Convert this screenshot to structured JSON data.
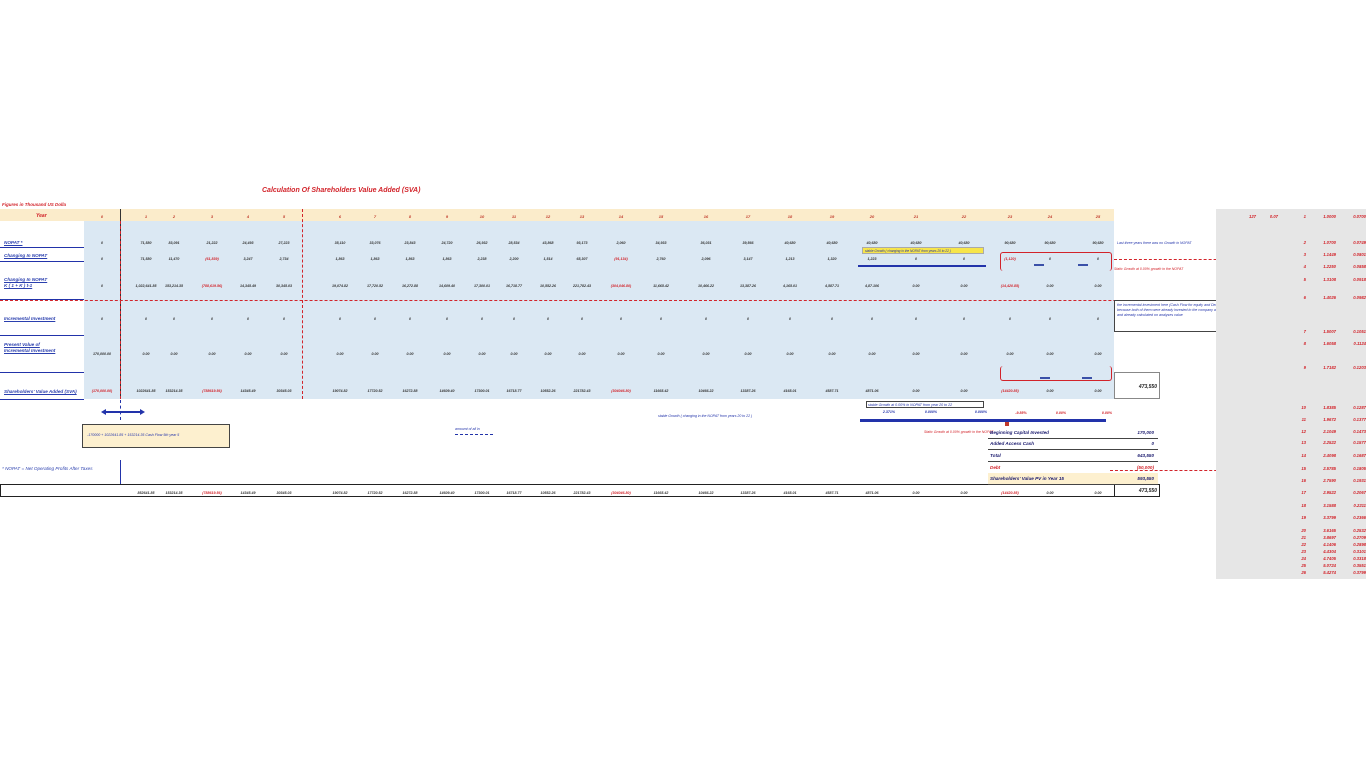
{
  "title": "Calculation Of Shareholders Value Added (SVA)",
  "figures_note": "Figures in Thousand US Dolla",
  "year_label": "Year",
  "years": [
    "0",
    "1",
    "2",
    "3",
    "4",
    "5",
    "6",
    "7",
    "8",
    "9",
    "10",
    "11",
    "12",
    "13",
    "14",
    "15",
    "16",
    "17",
    "18",
    "19",
    "20",
    "21",
    "22",
    "23",
    "24",
    "25"
  ],
  "rows": {
    "nopat": {
      "label": "NOPAT *",
      "values": [
        "0",
        "71,580",
        "83,091",
        "21,222",
        "24,493",
        "27,223",
        "35,110",
        "33,076",
        "23,843",
        "24,720",
        "26,932",
        "28,534",
        "43,868",
        "93,173",
        "2,060",
        "34,933",
        "36,031",
        "39,566",
        "40,680",
        "40,680",
        "40,680",
        "40,680",
        "40,680",
        "90,680",
        "90,680",
        "90,680"
      ]
    },
    "changing_nopat": {
      "label": "Changing In NOPAT",
      "values": [
        "0",
        "71,580",
        "11,470",
        "(61,839)",
        "3,247",
        "2,734",
        "1,863",
        "1,863",
        "1,863",
        "1,863",
        "2,238",
        "2,200",
        "1,514",
        "65,307",
        "(91,134)",
        "2,760",
        "2,096",
        "3,147",
        "1,213",
        "1,320",
        "1,223",
        "0",
        "0",
        "(1,120)",
        "0",
        "0"
      ]
    },
    "changing_nopat_k": {
      "label": "Changing In NOPAT\nK ( 1 + K ) t-1",
      "values": [
        "0",
        "1,022,641.85",
        "153,214.35",
        "(788,619.56)",
        "14,345.49",
        "30,345.03",
        "19,074.82",
        "17,720.52",
        "16,272.88",
        "14,609.40",
        "17,300.01",
        "16,718.77",
        "10,552.26",
        "221,782.43",
        "(304,046.80)",
        "11,665.42",
        "10,466.22",
        "13,387.26",
        "4,165.01",
        "4,587.71",
        "4,87.106",
        "0.00",
        "0.00",
        "(14,420.85)",
        "0.00",
        "0.00"
      ]
    },
    "incremental_investment": {
      "label": "Incremental Investment",
      "values": [
        "0",
        "0",
        "0",
        "0",
        "0",
        "0",
        "0",
        "0",
        "0",
        "0",
        "0",
        "0",
        "0",
        "0",
        "0",
        "0",
        "0",
        "0",
        "0",
        "0",
        "0",
        "0",
        "0",
        "0",
        "0",
        "0"
      ]
    },
    "pv_incremental": {
      "label": "Present Value of\nIncremental Investment",
      "values": [
        "170,000.00",
        "0.00",
        "0.00",
        "0.00",
        "0.00",
        "0.00",
        "0.00",
        "0.00",
        "0.00",
        "0.00",
        "0.00",
        "0.00",
        "0.00",
        "0.00",
        "0.00",
        "0.00",
        "0.00",
        "0.00",
        "0.00",
        "0.00",
        "0.00",
        "0.00",
        "0.00",
        "0.00",
        "0.00",
        "0.00"
      ]
    },
    "sva": {
      "label": "Shareholders' Value Added (SVA)",
      "values": [
        "(170,000.00)",
        "1022641.85",
        "153214.35",
        "(788619.56)",
        "14345.49",
        "30345.03",
        "19074.82",
        "17720.52",
        "16272.88",
        "14609.40",
        "17300.01",
        "16718.77",
        "10552.26",
        "221782.43",
        "(304046.80)",
        "11665.42",
        "10466.22",
        "13387.26",
        "4165.01",
        "4587.71",
        "4871.06",
        "0.00",
        "0.00",
        "(14420.85)",
        "0.00",
        "0.00"
      ]
    }
  },
  "sva_total": "473,550",
  "bottom_row": [
    "852641.85",
    "153214.35",
    "(788619.56)",
    "14345.49",
    "30345.03",
    "19074.82",
    "17720.52",
    "16272.88",
    "14609.40",
    "17300.01",
    "16718.77",
    "10552.26",
    "221782.43",
    "(304046.80)",
    "11665.42",
    "10466.22",
    "13387.26",
    "4165.01",
    "4587.71",
    "4871.06",
    "0.00",
    "0.00",
    "(14420.85)",
    "0.00",
    "0.00"
  ],
  "bottom_total": "473,550",
  "growth_row": {
    "values": [
      "2.371%",
      "0.000%",
      "0.000%",
      "-9.85%",
      "0.00%",
      "0.00%"
    ]
  },
  "notes": {
    "box_left": "-170000 + 1022641.85 + 153214.35 Cash Flow 5th year 5",
    "footnote": "* NOPAT = Net Operating Profits After Taxes",
    "last_three_years": "Last three years there was no Growth in NOPAT",
    "static_growth_right": "Static Growth at 0.00% growth in the NOPAT",
    "incremental_note": "the incremental investment here (Cash Flow for equity and Debt) is equal zero because both of them were already invested in the company at free cash flow and already calculated on analyses value",
    "stable_growth_top": "stable Growth ( changing in the NOPAT from years 20 to 22 )",
    "stable_growth_mid": "stable Growth ( changing in the NOPAT from years 20 to 22 )",
    "stable_growth_box": "stable Growth at 0.00% in NOPAT from year 20 to 22",
    "static_growth_bottom": "Static Growth at 0.00% growth in the NOPAT",
    "small_label": "amoumt of all in"
  },
  "summary": [
    {
      "label": "Beginning Capital Invested",
      "value": "170,000"
    },
    {
      "label": "Added Access Cash",
      "value": "0"
    },
    {
      "label": "Total",
      "value": "643,550"
    },
    {
      "label": "Debt",
      "value": "(50,000)"
    },
    {
      "label": "Shareholders' Value PV in Year 15",
      "value": "593,550"
    }
  ],
  "right_panel": {
    "header": [
      "127",
      "0.07"
    ],
    "rows": [
      [
        "1",
        "1.0000",
        "0.0700"
      ],
      [
        "2",
        "1.0700",
        "0.0749"
      ],
      [
        "3",
        "1.1449",
        "0.0801"
      ],
      [
        "4",
        "1.2250",
        "0.0858"
      ],
      [
        "5",
        "1.3108",
        "0.0918"
      ],
      [
        "6",
        "1.4026",
        "0.0982"
      ],
      [
        "7",
        "1.5007",
        "0.1051"
      ],
      [
        "8",
        "1.6058",
        "0.1124"
      ],
      [
        "9",
        "1.7182",
        "0.1203"
      ],
      [
        "10",
        "1.8385",
        "0.1287"
      ],
      [
        "11",
        "1.9672",
        "0.1377"
      ],
      [
        "12",
        "2.1049",
        "0.1473"
      ],
      [
        "13",
        "2.2522",
        "0.1577"
      ],
      [
        "14",
        "2.4098",
        "0.1687"
      ],
      [
        "15",
        "2.5785",
        "0.1805"
      ],
      [
        "16",
        "2.7590",
        "0.1931"
      ],
      [
        "17",
        "2.9522",
        "0.2067"
      ],
      [
        "18",
        "3.1588",
        "0.2211"
      ],
      [
        "19",
        "3.3799",
        "0.2366"
      ],
      [
        "20",
        "3.6165",
        "0.2532"
      ],
      [
        "21",
        "3.8697",
        "0.2709"
      ],
      [
        "22",
        "4.1406",
        "0.2898"
      ],
      [
        "23",
        "4.4304",
        "0.3101"
      ],
      [
        "24",
        "4.7405",
        "0.3318"
      ],
      [
        "25",
        "5.0724",
        "0.3551"
      ],
      [
        "26",
        "5.4274",
        "0.3799"
      ]
    ]
  }
}
